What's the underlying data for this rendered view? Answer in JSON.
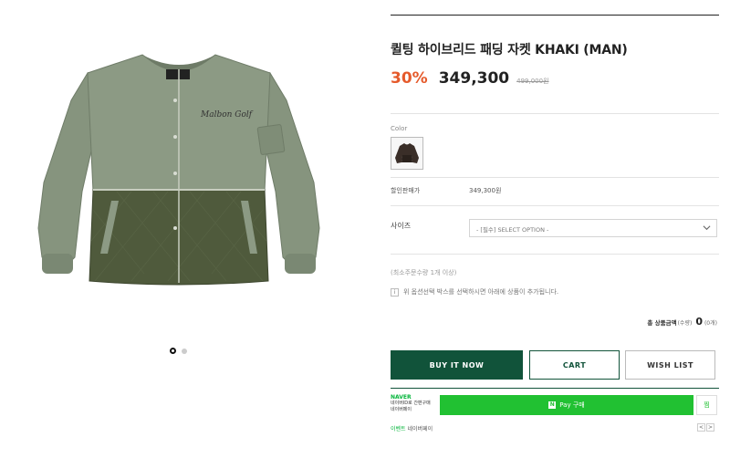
{
  "product": {
    "title": "퀼팅 하이브리드 패딩 자켓 KHAKI (MAN)",
    "discount": "30%",
    "price": "349,300",
    "original_price": "499,000원",
    "brand_logo_text": "Malbon",
    "embroidery_text": "Malbon Golf"
  },
  "gallery": {
    "dots": [
      {
        "active": true
      },
      {
        "active": false
      }
    ]
  },
  "options": {
    "color_label": "Color",
    "sale_price_label": "할인판매가",
    "sale_price_value": "349,300원",
    "size_label": "사이즈",
    "size_placeholder": "- [필수] SELECT OPTION -"
  },
  "order": {
    "min_order": "(최소주문수량 1개 이상)",
    "notice_icon": "i",
    "notice": "위 옵션선택 박스를 선택하시면 아래에 상품이 추가됩니다.",
    "total_label": "총 상품금액",
    "total_qty_label": "(수량)",
    "total_value": "0",
    "total_count": "(0개)"
  },
  "buttons": {
    "buy": "BUY IT NOW",
    "cart": "CART",
    "wish": "WISH LIST"
  },
  "naver": {
    "logo": "NAVER",
    "line1": "네이버ID로 간편구매",
    "line2": "네이버페이",
    "pay_label": "Pay 구매",
    "pay_icon": "N",
    "zzim": "찜",
    "event_link": "이벤트",
    "event_text": "네이버페이",
    "prev": "<",
    "next": ">"
  },
  "colors": {
    "brand_green": "#11533a",
    "discount_orange": "#e55a2b",
    "naver_green": "#21c132",
    "jacket_upper": "#8c9a84",
    "jacket_lower": "#4f5a3c"
  },
  "icons": [
    "chevron-down-icon",
    "info-icon",
    "naver-pay-icon",
    "carousel-dot-icon"
  ]
}
